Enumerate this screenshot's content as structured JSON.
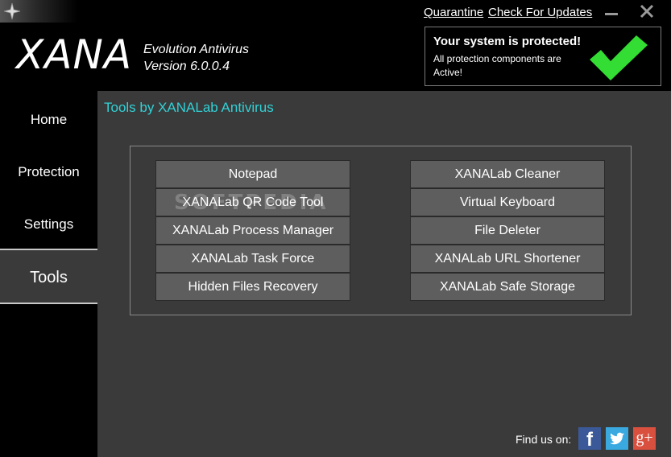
{
  "header": {
    "logo": "XANA",
    "product_name": "Evolution Antivirus",
    "version": "Version 6.0.0.4",
    "links": {
      "quarantine": "Quarantine",
      "check_updates": "Check For Updates"
    },
    "status": {
      "title": "Your system is protected!",
      "subtitle": "All protection components are Active!",
      "color": "#33dd33"
    }
  },
  "sidebar": {
    "items": [
      {
        "label": "Home"
      },
      {
        "label": "Protection"
      },
      {
        "label": "Settings"
      },
      {
        "label": "Tools",
        "selected": true
      }
    ]
  },
  "main": {
    "title": "Tools by XANALab Antivirus",
    "title_color": "#31d1d6",
    "tools_left": [
      "Notepad",
      "XANALab QR Code Tool",
      "XANALab Process Manager",
      "XANALab Task Force",
      "Hidden Files Recovery"
    ],
    "tools_right": [
      "XANALab Cleaner",
      "Virtual Keyboard",
      "File Deleter",
      "XANALab URL Shortener",
      "XANALab Safe Storage"
    ],
    "watermark": "SOFTPEDIA",
    "footer": {
      "find_us": "Find us on:",
      "social": [
        {
          "icon": "facebook-icon",
          "glyph": "f"
        },
        {
          "icon": "twitter-icon",
          "glyph": ""
        },
        {
          "icon": "google-plus-icon",
          "glyph": "g+"
        }
      ]
    }
  }
}
